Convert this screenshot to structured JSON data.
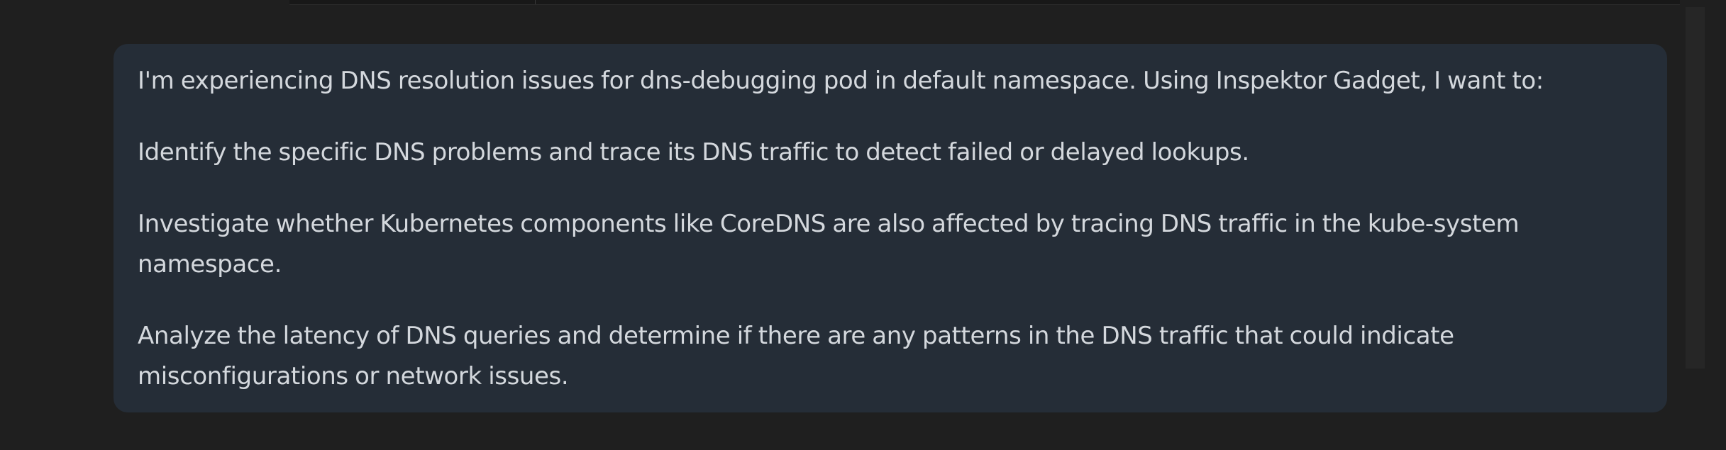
{
  "chat": {
    "user_message": {
      "paragraphs": [
        "I'm experiencing DNS resolution issues for dns-debugging pod in default namespace. Using Inspektor Gadget, I want to:",
        "Identify the specific DNS problems and trace its DNS traffic to detect failed or delayed lookups.",
        "Investigate whether Kubernetes components like CoreDNS are also affected by tracing DNS traffic in the kube-system namespace.",
        "Analyze the latency of DNS queries and determine if there are any patterns in the DNS traffic that could indicate misconfigurations or network issues."
      ]
    }
  },
  "colors": {
    "background": "#1f1f1f",
    "bubble": "#252d37",
    "text": "#d4d8dd"
  }
}
